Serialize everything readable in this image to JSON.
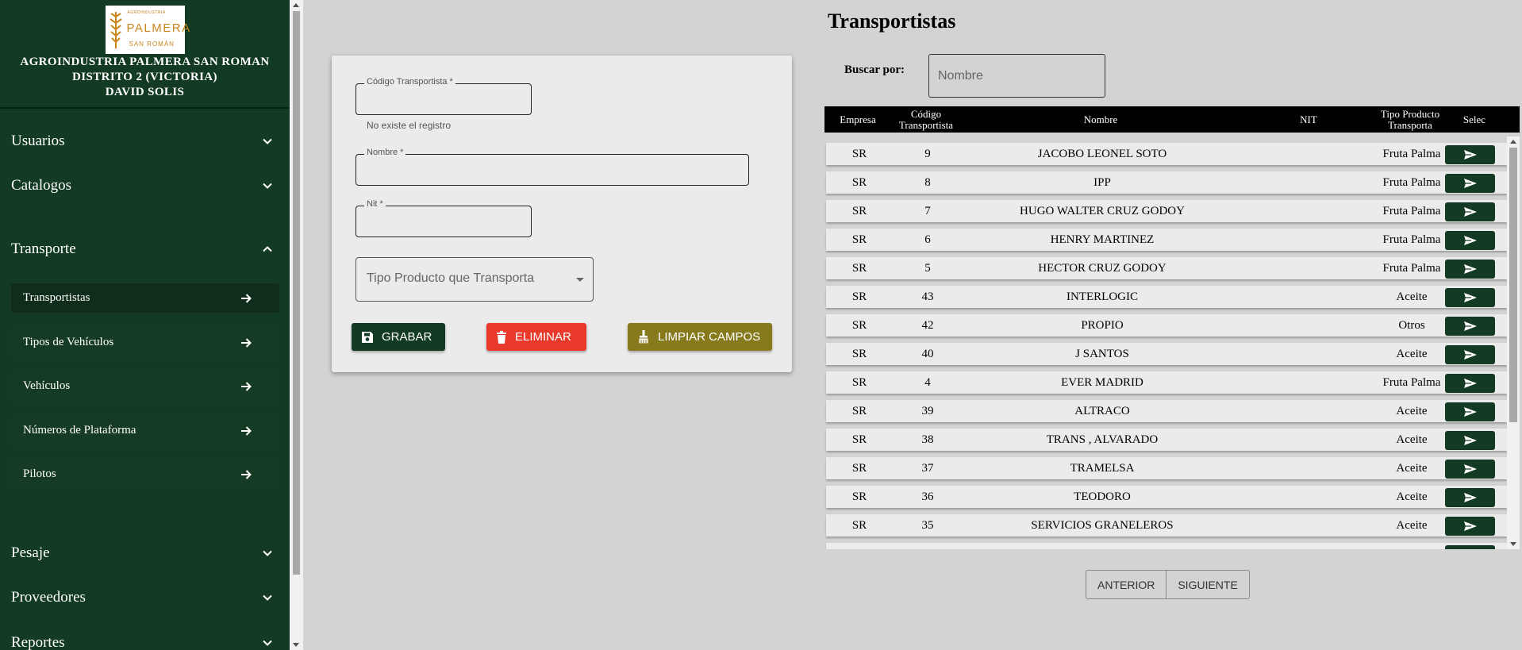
{
  "brand": {
    "logo_top": "AGROINDUSTRIA",
    "logo_main": "PALMERA",
    "logo_bottom": "SAN ROMÁN",
    "line1": "AGROINDUSTRIA PALMERA SAN ROMAN",
    "line2": "DISTRITO 2 (VICTORIA)",
    "line3": "DAVID SOLIS"
  },
  "sidebar": {
    "sections": [
      {
        "label": "Usuarios",
        "expanded": false
      },
      {
        "label": "Catalogos",
        "expanded": false
      },
      {
        "label": "Transporte",
        "expanded": true
      },
      {
        "label": "Pesaje",
        "expanded": false
      },
      {
        "label": "Proveedores",
        "expanded": false
      },
      {
        "label": "Reportes",
        "expanded": false
      }
    ],
    "transporte_items": [
      {
        "label": "Transportistas",
        "active": true
      },
      {
        "label": "Tipos de Vehículos",
        "active": false
      },
      {
        "label": "Vehículos",
        "active": false
      },
      {
        "label": "Números de Plataforma",
        "active": false
      },
      {
        "label": "Pilotos",
        "active": false
      }
    ]
  },
  "form": {
    "codigo_label": "Código Transportista *",
    "codigo_value": "",
    "codigo_helper": "No existe el registro",
    "nombre_label": "Nombre *",
    "nombre_value": "",
    "nit_label": "Nit *",
    "nit_value": "",
    "tipo_placeholder": "Tipo Producto que Transporta",
    "save_label": "GRABAR",
    "delete_label": "ELIMINAR",
    "clear_label": "LIMPIAR CAMPOS"
  },
  "list": {
    "title": "Transportistas",
    "search_label": "Buscar por:",
    "search_placeholder": "Nombre",
    "columns": [
      "Empresa",
      "Código Transportista",
      "Nombre",
      "NIT",
      "Tipo Producto Transporta",
      "Selec"
    ],
    "rows": [
      {
        "empresa": "SR",
        "codigo": "9",
        "nombre": "JACOBO LEONEL SOTO",
        "nit": "",
        "tipo": "Fruta Palma"
      },
      {
        "empresa": "SR",
        "codigo": "8",
        "nombre": "IPP",
        "nit": "",
        "tipo": "Fruta Palma"
      },
      {
        "empresa": "SR",
        "codigo": "7",
        "nombre": "HUGO WALTER CRUZ GODOY",
        "nit": "",
        "tipo": "Fruta Palma"
      },
      {
        "empresa": "SR",
        "codigo": "6",
        "nombre": "HENRY MARTINEZ",
        "nit": "",
        "tipo": "Fruta Palma"
      },
      {
        "empresa": "SR",
        "codigo": "5",
        "nombre": "HECTOR CRUZ GODOY",
        "nit": "",
        "tipo": "Fruta Palma"
      },
      {
        "empresa": "SR",
        "codigo": "43",
        "nombre": "INTERLOGIC",
        "nit": "",
        "tipo": "Aceite"
      },
      {
        "empresa": "SR",
        "codigo": "42",
        "nombre": "PROPIO",
        "nit": "",
        "tipo": "Otros"
      },
      {
        "empresa": "SR",
        "codigo": "40",
        "nombre": "J SANTOS",
        "nit": "",
        "tipo": "Aceite"
      },
      {
        "empresa": "SR",
        "codigo": "4",
        "nombre": "EVER MADRID",
        "nit": "",
        "tipo": "Fruta Palma"
      },
      {
        "empresa": "SR",
        "codigo": "39",
        "nombre": "ALTRACO",
        "nit": "",
        "tipo": "Aceite"
      },
      {
        "empresa": "SR",
        "codigo": "38",
        "nombre": "TRANS , ALVARADO",
        "nit": "",
        "tipo": "Aceite"
      },
      {
        "empresa": "SR",
        "codigo": "37",
        "nombre": "TRAMELSA",
        "nit": "",
        "tipo": "Aceite"
      },
      {
        "empresa": "SR",
        "codigo": "36",
        "nombre": "TEODORO",
        "nit": "",
        "tipo": "Aceite"
      },
      {
        "empresa": "SR",
        "codigo": "35",
        "nombre": "SERVICIOS GRANELEROS",
        "nit": "",
        "tipo": "Aceite"
      }
    ],
    "prev_label": "ANTERIOR",
    "next_label": "SIGUIENTE"
  },
  "colors": {
    "primary": "#133a22",
    "danger": "#e8392b",
    "warning": "#867a1d",
    "background": "#d3d3d3"
  },
  "icons": {
    "section_toggle": "chevron-icon",
    "sub_item": "arrow-right-icon",
    "save": "floppy-disk-icon",
    "delete": "trash-icon",
    "clear": "broom-icon",
    "select": "send-icon"
  }
}
